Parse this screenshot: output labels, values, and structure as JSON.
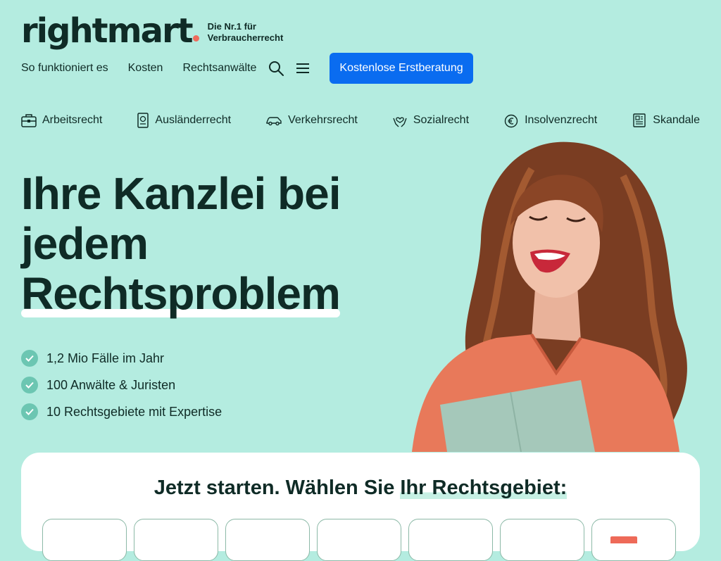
{
  "brand": {
    "name": "rightmart",
    "tagline_line1": "Die Nr.1 für",
    "tagline_line2": "Verbraucherrecht",
    "accent": "#ef6b5c"
  },
  "topnav": {
    "items": [
      "So funktioniert es",
      "Kosten",
      "Rechtsanwälte"
    ],
    "search_icon": "search-icon",
    "menu_icon": "hamburger-menu-icon",
    "cta_label": "Kostenlose Erstberatung",
    "cta_color": "#0a6cf0"
  },
  "categories": [
    {
      "label": "Arbeitsrecht",
      "icon": "briefcase-icon"
    },
    {
      "label": "Ausländerrecht",
      "icon": "passport-icon"
    },
    {
      "label": "Verkehrsrecht",
      "icon": "car-icon"
    },
    {
      "label": "Sozialrecht",
      "icon": "hands-heart-icon"
    },
    {
      "label": "Insolvenzrecht",
      "icon": "euro-piggy-icon"
    },
    {
      "label": "Skandale",
      "icon": "newspaper-icon"
    }
  ],
  "hero": {
    "line1": "Ihre Kanzlei bei",
    "line2": "jedem",
    "line3": "Rechtsproblem",
    "bullets": [
      "1,2 Mio Fälle im Jahr",
      "100 Anwälte & Juristen",
      "10 Rechtsgebiete mit Expertise"
    ]
  },
  "start": {
    "title_part1": "Jetzt starten. Wählen Sie ",
    "title_part2": "Ihr Rechtsgebiet:"
  },
  "colors": {
    "background": "#b4ece0",
    "text": "#0f2b26",
    "check": "#6cc6b2"
  }
}
